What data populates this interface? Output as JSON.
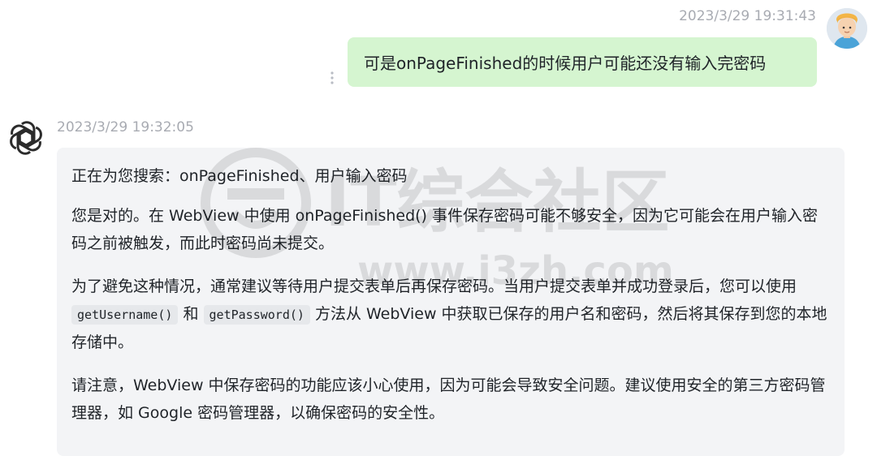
{
  "user_message": {
    "timestamp": "2023/3/29 19:31:43",
    "text": "可是onPageFinished的时候用户可能还没有输入完密码"
  },
  "bot_message": {
    "timestamp": "2023/3/29 19:32:05",
    "searching": "正在为您搜索：onPageFinished、用户输入密码",
    "para1": "您是对的。在 WebView 中使用 onPageFinished() 事件保存密码可能不够安全，因为它可能会在用户输入密码之前被触发，而此时密码尚未提交。",
    "para2_a": "为了避免这种情况，通常建议等待用户提交表单后再保存密码。当用户提交表单并成功登录后，您可以使用",
    "code1": "getUsername()",
    "para2_b": "和",
    "code2": "getPassword()",
    "para2_c": "方法从 WebView 中获取已保存的用户名和密码，然后将其保存到您的本地存储中。",
    "para3": "请注意，WebView 中保存密码的功能应该小心使用，因为可能会导致安全问题。建议使用安全的第三方密码管理器，如 Google 密码管理器，以确保密码的安全性。"
  },
  "watermark": {
    "line1": "IT综合社区",
    "line2": "www.i3zh.com"
  },
  "icons": {
    "user_avatar": "user-avatar",
    "bot_logo": "openai-logo-icon",
    "more": "more-vertical-icon"
  }
}
